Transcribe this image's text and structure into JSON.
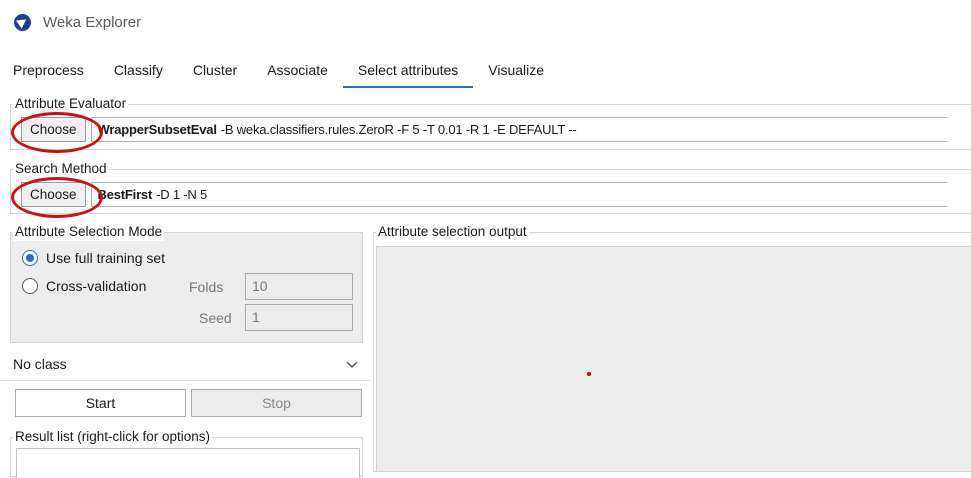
{
  "window": {
    "title": "Weka Explorer",
    "icon": "weka-bird-icon"
  },
  "tabs": [
    {
      "label": "Preprocess",
      "active": false
    },
    {
      "label": "Classify",
      "active": false
    },
    {
      "label": "Cluster",
      "active": false
    },
    {
      "label": "Associate",
      "active": false
    },
    {
      "label": "Select attributes",
      "active": true
    },
    {
      "label": "Visualize",
      "active": false
    }
  ],
  "attribute_evaluator": {
    "title": "Attribute Evaluator",
    "choose_label": "Choose",
    "name": "WrapperSubsetEval",
    "options": "-B weka.classifiers.rules.ZeroR -F 5 -T 0.01 -R 1 -E DEFAULT --"
  },
  "search_method": {
    "title": "Search Method",
    "choose_label": "Choose",
    "name": "BestFirst",
    "options": "-D 1 -N 5"
  },
  "selection_mode": {
    "title": "Attribute Selection Mode",
    "full_training_label": "Use full training set",
    "cross_validation_label": "Cross-validation",
    "selected": "full_training",
    "folds_label": "Folds",
    "folds_value": "10",
    "seed_label": "Seed",
    "seed_value": "1"
  },
  "class_select": {
    "value": "No class"
  },
  "actions": {
    "start_label": "Start",
    "stop_label": "Stop"
  },
  "result_list": {
    "title": "Result list (right-click for options)"
  },
  "output": {
    "title": "Attribute selection output"
  },
  "colors": {
    "accent": "#2b6cd4",
    "highlight_circle": "#cc1111",
    "icon": "#1f3f8f"
  }
}
